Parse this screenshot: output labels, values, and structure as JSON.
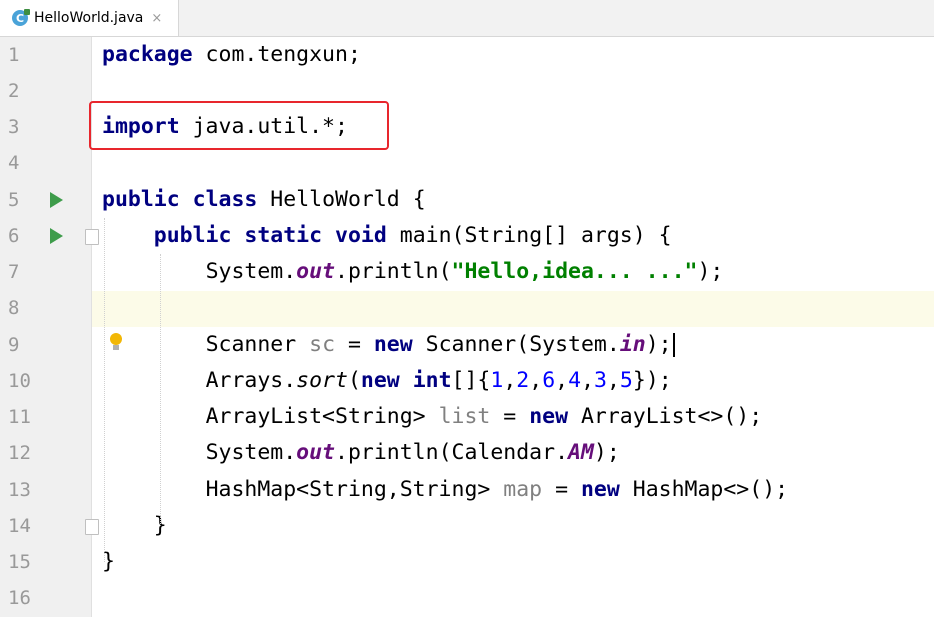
{
  "tab": {
    "title": "HelloWorld.java",
    "icon": "java-class-icon",
    "close": "×"
  },
  "editor": {
    "line_numbers": [
      "1",
      "2",
      "3",
      "4",
      "5",
      "6",
      "7",
      "8",
      "9",
      "10",
      "11",
      "12",
      "13",
      "14",
      "15",
      "16"
    ],
    "current_line": "9",
    "highlight_box_color": "#e8262d",
    "lines": {
      "l1": {
        "kw": "package",
        "rest": " com.tengxun;"
      },
      "l3": {
        "kw": "import",
        "rest": " java.util.*;"
      },
      "l5": {
        "kw1": "public",
        "kw2": "class",
        "rest": " HelloWorld {"
      },
      "l6": {
        "kw1": "public",
        "kw2": "static",
        "kw3": "void",
        "rest": " main(String[] args) {"
      },
      "l7": {
        "a": "System.",
        "field": "out",
        "b": ".println(",
        "str": "\"Hello,idea... ...\"",
        "c": ");"
      },
      "l9": {
        "a": "Scanner ",
        "var": "sc",
        "b": " = ",
        "kw": "new",
        "c": " Scanner(System.",
        "field": "in",
        "d": ");"
      },
      "l10": {
        "a": "Arrays.",
        "method": "sort",
        "b": "(",
        "kw1": "new",
        "sp": " ",
        "kw2": "int",
        "c": "[]{",
        "n1": "1",
        "n2": "2",
        "n3": "6",
        "n4": "4",
        "n5": "3",
        "n6": "5",
        "comma": ",",
        "d": "});"
      },
      "l11": {
        "a": "ArrayList<String> ",
        "var": "list",
        "b": " = ",
        "kw": "new",
        "c": " ArrayList<>();"
      },
      "l12": {
        "a": "System.",
        "field1": "out",
        "b": ".println(Calendar.",
        "field2": "AM",
        "c": ");"
      },
      "l13": {
        "a": "HashMap<String,String> ",
        "var": "map",
        "b": " = ",
        "kw": "new",
        "c": " HashMap<>();"
      },
      "l14": {
        "a": "}"
      },
      "l15": {
        "a": "}"
      }
    }
  }
}
